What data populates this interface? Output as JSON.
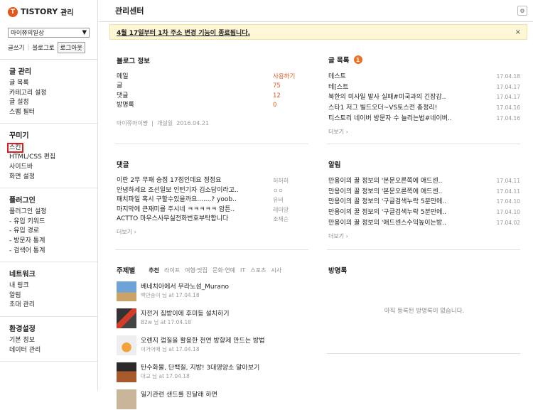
{
  "app": {
    "logo_mark": "T",
    "logo": "TISTORY",
    "logo_sub": "관리"
  },
  "blog_select": {
    "value": "마이쮸의일상",
    "arrow": "▼"
  },
  "top_links": {
    "write": "글쓰기",
    "sep": "|",
    "blog_home": "블로그로",
    "logout": "로그아웃"
  },
  "sidebar": {
    "groups": [
      {
        "title": "글 관리",
        "items": [
          "글 목록",
          "카테고리 설정",
          "글 설정",
          "스팸 필터"
        ]
      },
      {
        "title": "꾸미기",
        "items": [
          "스킨",
          "HTML/CSS 편집",
          "사이드바",
          "화면 설정"
        ]
      },
      {
        "title": "플러그인",
        "items": [
          "플러그인 설정",
          "- 유입 키워드",
          "- 유입 경로",
          "- 방문자 통계",
          "- 검색어 통계"
        ]
      },
      {
        "title": "네트워크",
        "items": [
          "내 링크",
          "알림",
          "초대 관리"
        ]
      },
      {
        "title": "환경설정",
        "items": [
          "기본 정보",
          "데이터 관리"
        ]
      }
    ]
  },
  "header": {
    "title": "관리센터",
    "settings_icon": "gear-icon",
    "gear_glyph": "⚙"
  },
  "notice": {
    "text": "4월 17일부터 1차 주소 변경 기능이 종료됩니다.",
    "close": "×"
  },
  "blog_info": {
    "title": "블로그 정보",
    "rows": [
      {
        "label": "메일",
        "value": "사용하기"
      },
      {
        "label": "글",
        "value": "75"
      },
      {
        "label": "댓글",
        "value": "12"
      },
      {
        "label": "방명록",
        "value": "0"
      }
    ],
    "owner": "마이쮸마이쨩",
    "opened_label": "개설일",
    "opened": "2016.04.21"
  },
  "posts": {
    "title": "글 목록",
    "badge": "1",
    "rows": [
      {
        "t": "테스트",
        "d": "17.04.18"
      },
      {
        "t": "테[스트",
        "d": "17.04.17"
      },
      {
        "t": "북한의 미사일 발사 실패#미국과의 긴장감..",
        "d": "17.04.17"
      },
      {
        "t": "스타1 저그 빌드오더~VS토스전 총정리!",
        "d": "17.04.16"
      },
      {
        "t": "티스토리 네이버 방문자 수 늘리는법#네이버..",
        "d": "17.04.16"
      }
    ],
    "more": "더보기 ›"
  },
  "comments": {
    "title": "댓글",
    "rows": [
      {
        "t": "이란 2무 무패 승점 17점인데요 정정요",
        "a": "허허허"
      },
      {
        "t": "안녕하세요 조선일보 인턴기자 김소담이라고..",
        "a": "ㅇㅇ"
      },
      {
        "t": "패치파일 혹시 구할수있을까요.......? yoob..",
        "a": "유비"
      },
      {
        "t": "마지막에 큰재미를 주시네 ㅋㅋㅋㅋㅋ 암튼..",
        "a": "레미망"
      },
      {
        "t": "ACTTO 마우스사무실전화번호부탁합니다",
        "a": "조재순"
      }
    ],
    "more": "더보기 ›"
  },
  "alerts": {
    "title": "알림",
    "rows": [
      {
        "t": "만용이의 꿀 정보의 '본문오른쪽에 애드센..",
        "d": "17.04.11"
      },
      {
        "t": "만용이의 꿀 정보의 '본문오른쪽에 애드센..",
        "d": "17.04.11"
      },
      {
        "t": "만용이의 꿀 정보의 '구글검색누락 5분만에..",
        "d": "17.04.10"
      },
      {
        "t": "만용이의 꿀 정보의 '구글검색누락 5분만에..",
        "d": "17.04.10"
      },
      {
        "t": "만용이의 꿀 정보의 '애드센스수익높이는방..",
        "d": "17.04.02"
      }
    ],
    "more": "더보기 ›"
  },
  "topics": {
    "title": "주제별",
    "tabs": [
      "추천",
      "라이프",
      "여행·맛집",
      "문화·연예",
      "IT",
      "스포츠",
      "시사"
    ],
    "items": [
      {
        "t": "베네치아에서 무라노섬_Murano",
        "m": "백만송이 님 at 17.04.18"
      },
      {
        "t": "자전거 짐받이에 후미등 설치하기",
        "m": "B2w 님 at 17.04.18"
      },
      {
        "t": "오렌지 껍질을 활용한 천연 방향제 만드는 방법",
        "m": "이거어때 님 at 17.04.18"
      },
      {
        "t": "탄수화물, 단백질, 지방! 3대영양소 알아보기",
        "m": "대교 님 at 17.04.18"
      },
      {
        "t": "일기관련 샌드를 진달래 하면",
        "m": ""
      }
    ]
  },
  "guestbook": {
    "title": "방명록",
    "empty": "아직 등록된 방명록이 없습니다."
  },
  "colors": {
    "accent": "#e8541a",
    "notice_bg": "#fdf7d7",
    "active_outline": "#e01b1b"
  }
}
